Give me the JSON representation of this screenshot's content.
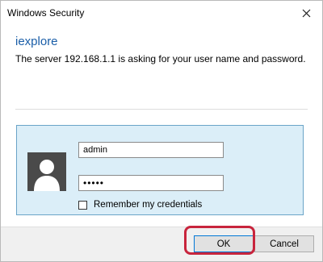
{
  "window": {
    "title": "Windows Security",
    "close_icon": "close-icon"
  },
  "content": {
    "app_name": "iexplore",
    "message": "The server 192.168.1.1 is asking for your user name and password."
  },
  "credentials": {
    "avatar_icon": "user-silhouette-icon",
    "username_value": "admin",
    "password_value": "•••••",
    "remember_label": "Remember my credentials",
    "remember_checked": false
  },
  "buttons": {
    "ok_label": "OK",
    "cancel_label": "Cancel"
  },
  "colors": {
    "app_name": "#1a5ea8",
    "panel_bg": "#dbeef8",
    "panel_border": "#6aa4c8",
    "highlight": "#c8243c"
  }
}
